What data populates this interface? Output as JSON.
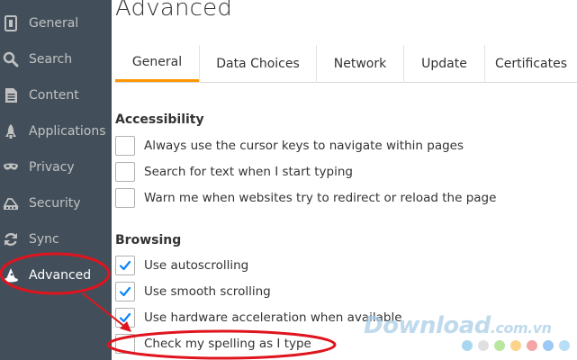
{
  "sidebar": {
    "items": [
      {
        "label": "General",
        "icon": "general-icon"
      },
      {
        "label": "Search",
        "icon": "search-icon"
      },
      {
        "label": "Content",
        "icon": "content-icon"
      },
      {
        "label": "Applications",
        "icon": "rocket-icon"
      },
      {
        "label": "Privacy",
        "icon": "mask-icon"
      },
      {
        "label": "Security",
        "icon": "security-icon"
      },
      {
        "label": "Sync",
        "icon": "sync-icon"
      },
      {
        "label": "Advanced",
        "icon": "wizard-hat-icon",
        "active": true
      }
    ]
  },
  "page_title": "Advanced",
  "tabs": [
    {
      "label": "General",
      "selected": true
    },
    {
      "label": "Data Choices"
    },
    {
      "label": "Network"
    },
    {
      "label": "Update"
    },
    {
      "label": "Certificates"
    }
  ],
  "accessibility": {
    "title": "Accessibility",
    "options": [
      {
        "label": "Always use the cursor keys to navigate within pages",
        "checked": false
      },
      {
        "label": "Search for text when I start typing",
        "checked": false
      },
      {
        "label": "Warn me when websites try to redirect or reload the page",
        "checked": false
      }
    ]
  },
  "browsing": {
    "title": "Browsing",
    "options": [
      {
        "label": "Use autoscrolling",
        "checked": true
      },
      {
        "label": "Use smooth scrolling",
        "checked": true
      },
      {
        "label": "Use hardware acceleration when available",
        "checked": true
      },
      {
        "label": "Check my spelling as I type",
        "checked": false
      }
    ]
  },
  "watermark": {
    "text": "Download",
    "suffix": ".com.vn"
  },
  "colors": {
    "sidebar_bg": "#424f5a",
    "tab_accent": "#ff9500",
    "check_color": "#0a84ff",
    "annotation_red": "#e0141e",
    "dot_colors": [
      "#a8d8f0",
      "#e0e0e0",
      "#b9e6a1",
      "#fbd38d",
      "#f4a6a6",
      "#9cc9f5",
      "#b8dff5"
    ]
  }
}
